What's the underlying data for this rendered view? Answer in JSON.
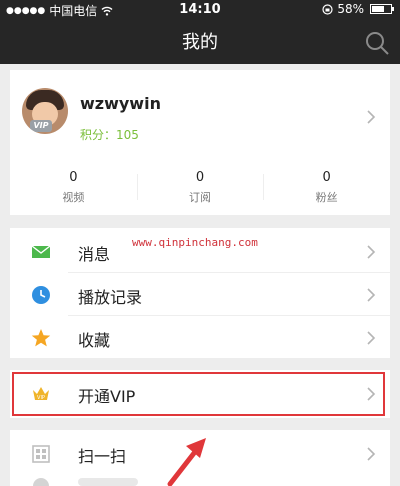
{
  "status_bar": {
    "signal": "●●●●●",
    "carrier": "中国电信",
    "time": "14:10",
    "battery_text": "58%",
    "battery_level": 0.58
  },
  "header": {
    "title": "我的"
  },
  "profile": {
    "username": "wzwywin",
    "avatar_badge": "VIP",
    "points_label": "积分",
    "points_value": "105",
    "points_text": "积分：105",
    "stats": [
      {
        "value": "0",
        "label": "视频"
      },
      {
        "value": "0",
        "label": "订阅"
      },
      {
        "value": "0",
        "label": "粉丝"
      }
    ]
  },
  "menu": {
    "items": [
      {
        "label": "消息",
        "icon": "message-icon"
      },
      {
        "label": "播放记录",
        "icon": "clock-icon"
      },
      {
        "label": "收藏",
        "icon": "star-icon"
      }
    ]
  },
  "vip": {
    "label": "开通VIP",
    "icon": "crown-icon"
  },
  "tools": {
    "items": [
      {
        "label": "扫一扫",
        "icon": "scan-icon"
      }
    ]
  },
  "watermark": "www.qinpinchang.com",
  "colors": {
    "header_bg": "#262626",
    "points": "#7bbf3b",
    "highlight": "#e0373a",
    "message_icon": "#4cb84c",
    "clock_icon": "#2f8fe0",
    "star_icon": "#f5a623"
  }
}
